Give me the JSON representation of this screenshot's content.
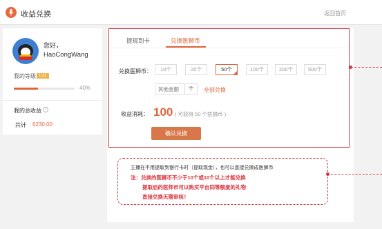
{
  "header": {
    "title": "收益兑换",
    "back_link": "返回首页",
    "logo_icon": "microphone-icon",
    "accent": "#e0653a"
  },
  "profile": {
    "greeting": "您好，",
    "username": "HaoCongWang",
    "level_label": "我的等级",
    "level_badge": "LV1",
    "level_progress": 0.4,
    "level_percent_text": "40%",
    "income_label": "我的总收益",
    "sum_label": "共计",
    "sum_value": "6230.00"
  },
  "tabs": [
    {
      "label": "提现到卡",
      "active": false
    },
    {
      "label": "兑换医狮币",
      "active": true
    }
  ],
  "exchange": {
    "field_label": "兑换医狮币：",
    "options": [
      "10个",
      "20个",
      "50个",
      "100个",
      "200个",
      "500个"
    ],
    "selected_option": "50个",
    "other_placeholder": "其他金额",
    "unit": "个",
    "all_link": "全部兑换",
    "cost_label": "收益消耗：",
    "cost_value": "100",
    "cost_note": "( 可获得 50 个医狮币 )",
    "confirm_button": "确认兑换"
  },
  "annotation": {
    "line1": "主播在不用提取到银行卡时（提取现金），也可以直接兑换成医狮币",
    "line2": "注：兑换的医狮币不少于10个或10个以上才能兑换",
    "line3": "提取后的医师币可以购买平台同等额度的礼物",
    "line4": "直接兑换无需审核！",
    "color": "#d9363e"
  }
}
